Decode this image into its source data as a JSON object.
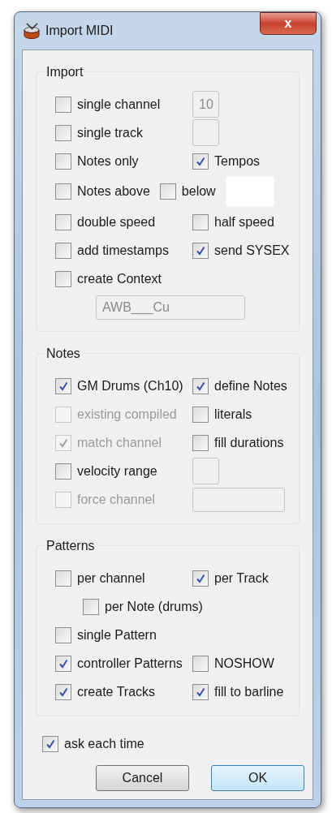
{
  "window": {
    "title": "Import MIDI",
    "close": "x"
  },
  "groups": [
    {
      "title": "Import",
      "rows": [
        [
          {
            "kind": "checkbox",
            "label": "single channel",
            "checked": false,
            "disabled": false
          },
          {
            "kind": "small-field",
            "value": "10",
            "disabled": true
          }
        ],
        [
          {
            "kind": "checkbox",
            "label": "single track",
            "checked": false,
            "disabled": false
          },
          {
            "kind": "small-field",
            "disabled": true
          }
        ],
        [
          {
            "kind": "checkbox",
            "label": "Notes only",
            "checked": false,
            "disabled": false
          },
          {
            "kind": "checkbox",
            "label": "Tempos",
            "checked": true,
            "disabled": false
          }
        ],
        [
          {
            "kind": "checkbox",
            "label": "Notes above",
            "checked": false,
            "disabled": false
          },
          {
            "kind": "checkbox",
            "label": "below",
            "checked": false,
            "disabled": false
          },
          {
            "kind": "wide-field",
            "disabled": false
          }
        ],
        [
          {
            "kind": "checkbox",
            "label": "double speed",
            "checked": false,
            "disabled": false
          },
          {
            "kind": "checkbox",
            "label": "half speed",
            "checked": false,
            "disabled": false
          }
        ],
        [
          {
            "kind": "checkbox",
            "label": "add timestamps",
            "checked": false,
            "disabled": false
          },
          {
            "kind": "checkbox",
            "label": "send SYSEX",
            "checked": true,
            "disabled": false
          }
        ],
        [
          {
            "kind": "checkbox",
            "label": "create Context",
            "checked": false,
            "disabled": false
          }
        ],
        [
          {
            "kind": "text-field",
            "value": "AWB___Cu",
            "disabled": true
          }
        ]
      ]
    },
    {
      "title": "Notes",
      "rows": [
        [
          {
            "kind": "checkbox",
            "label": "GM Drums (Ch10)",
            "checked": true,
            "disabled": false
          },
          {
            "kind": "checkbox",
            "label": "define Notes",
            "checked": true,
            "disabled": false
          }
        ],
        [
          {
            "kind": "checkbox",
            "label": "existing compiled",
            "checked": false,
            "disabled": true
          },
          {
            "kind": "checkbox",
            "label": "literals",
            "checked": false,
            "disabled": false
          }
        ],
        [
          {
            "kind": "checkbox",
            "label": "match channel",
            "checked": true,
            "disabled": true
          },
          {
            "kind": "checkbox",
            "label": "fill durations",
            "checked": false,
            "disabled": false
          }
        ],
        [
          {
            "kind": "checkbox",
            "label": "velocity range",
            "checked": false,
            "disabled": false
          },
          {
            "kind": "small-field",
            "disabled": true
          }
        ],
        [
          {
            "kind": "checkbox",
            "label": "force channel",
            "checked": false,
            "disabled": true
          },
          {
            "kind": "long-field",
            "disabled": true
          }
        ]
      ]
    },
    {
      "title": "Patterns",
      "rows": [
        [
          {
            "kind": "checkbox",
            "label": "per channel",
            "checked": false,
            "disabled": false
          },
          {
            "kind": "checkbox",
            "label": "per Track",
            "checked": true,
            "disabled": false
          }
        ],
        [
          {
            "kind": "indented-checkbox",
            "label": "per Note (drums)",
            "checked": false,
            "disabled": false
          }
        ],
        [
          {
            "kind": "checkbox",
            "label": "single Pattern",
            "checked": false,
            "disabled": false
          }
        ],
        [
          {
            "kind": "checkbox",
            "label": "controller Patterns",
            "checked": true,
            "disabled": false
          },
          {
            "kind": "checkbox",
            "label": "NOSHOW",
            "checked": false,
            "disabled": false
          }
        ],
        [
          {
            "kind": "checkbox",
            "label": "create Tracks",
            "checked": true,
            "disabled": false
          },
          {
            "kind": "checkbox",
            "label": "fill to barline",
            "checked": true,
            "disabled": false
          }
        ]
      ]
    }
  ],
  "ask_each_time": {
    "label": "ask each time",
    "checked": true
  },
  "buttons": [
    {
      "label": "Cancel",
      "default": false
    },
    {
      "label": "OK",
      "default": true
    }
  ]
}
